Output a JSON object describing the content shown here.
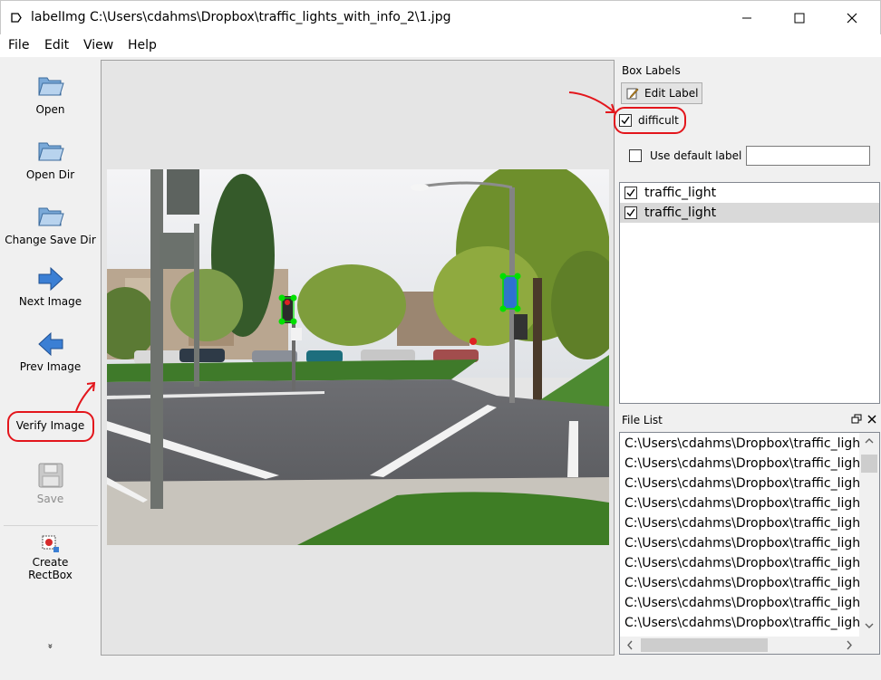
{
  "window": {
    "title": "labelImg C:\\Users\\cdahms\\Dropbox\\traffic_lights_with_info_2\\1.jpg",
    "app_icon": "labelimg-tag-icon"
  },
  "menu": {
    "items": [
      "File",
      "Edit",
      "View",
      "Help"
    ]
  },
  "toolbar": {
    "open": "Open",
    "open_dir": "Open Dir",
    "change_save_dir": "Change Save Dir",
    "next_image": "Next Image",
    "prev_image": "Prev Image",
    "verify_image": "Verify Image",
    "save": "Save",
    "create_rectbox_line1": "Create",
    "create_rectbox_line2": "RectBox",
    "more": "»"
  },
  "box_labels": {
    "title": "Box Labels",
    "edit_label": "Edit Label",
    "difficult": "difficult",
    "difficult_checked": true,
    "use_default_label": "Use default label",
    "use_default_checked": false,
    "default_label_value": "",
    "labels": [
      {
        "text": "traffic_light",
        "checked": true,
        "selected": false
      },
      {
        "text": "traffic_light",
        "checked": true,
        "selected": true
      }
    ]
  },
  "file_list": {
    "title": "File List",
    "rows": [
      "C:\\Users\\cdahms\\Dropbox\\traffic_light",
      "C:\\Users\\cdahms\\Dropbox\\traffic_light",
      "C:\\Users\\cdahms\\Dropbox\\traffic_light",
      "C:\\Users\\cdahms\\Dropbox\\traffic_light",
      "C:\\Users\\cdahms\\Dropbox\\traffic_light",
      "C:\\Users\\cdahms\\Dropbox\\traffic_light",
      "C:\\Users\\cdahms\\Dropbox\\traffic_light",
      "C:\\Users\\cdahms\\Dropbox\\traffic_light",
      "C:\\Users\\cdahms\\Dropbox\\traffic_light",
      "C:\\Users\\cdahms\\Dropbox\\traffic_light"
    ]
  },
  "colors": {
    "annotation_red": "#e3161c",
    "box_green": "#00e000",
    "box_blue": "#1565d8",
    "icon_blue": "#3b7fd4"
  }
}
